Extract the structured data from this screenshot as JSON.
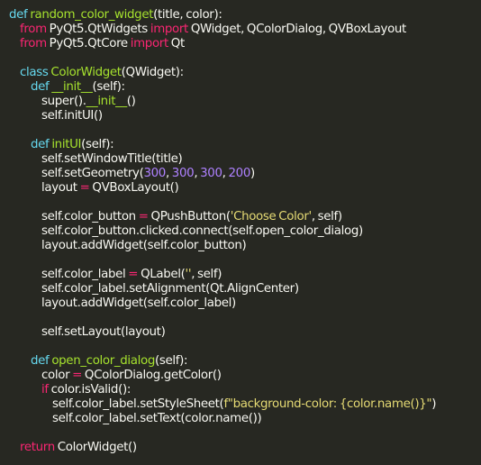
{
  "lines": [
    {
      "indent": 0,
      "tokens": [
        {
          "t": "kw",
          "v": "def "
        },
        {
          "t": "fn",
          "v": "random_color_widget"
        },
        {
          "t": "pl",
          "v": "(title, color):"
        }
      ]
    },
    {
      "indent": 1,
      "tokens": [
        {
          "t": "imp",
          "v": "from "
        },
        {
          "t": "pl",
          "v": "PyQt5.QtWidgets "
        },
        {
          "t": "imp",
          "v": "import "
        },
        {
          "t": "pl",
          "v": "QWidget, QColorDialog, QVBoxLayout"
        }
      ]
    },
    {
      "indent": 1,
      "tokens": [
        {
          "t": "imp",
          "v": "from "
        },
        {
          "t": "pl",
          "v": "PyQt5.QtCore "
        },
        {
          "t": "imp",
          "v": "import "
        },
        {
          "t": "pl",
          "v": "Qt"
        }
      ]
    },
    {
      "indent": 0,
      "tokens": []
    },
    {
      "indent": 1,
      "tokens": [
        {
          "t": "kw",
          "v": "class "
        },
        {
          "t": "fn",
          "v": "ColorWidget"
        },
        {
          "t": "pl",
          "v": "(QWidget):"
        }
      ]
    },
    {
      "indent": 2,
      "tokens": [
        {
          "t": "kw",
          "v": "def "
        },
        {
          "t": "fn",
          "v": "__init__"
        },
        {
          "t": "pl",
          "v": "(self):"
        }
      ]
    },
    {
      "indent": 3,
      "tokens": [
        {
          "t": "pl",
          "v": "super()."
        },
        {
          "t": "fn",
          "v": "__init__"
        },
        {
          "t": "pl",
          "v": "()"
        }
      ]
    },
    {
      "indent": 3,
      "tokens": [
        {
          "t": "pl",
          "v": "self.initUI()"
        }
      ]
    },
    {
      "indent": 0,
      "tokens": []
    },
    {
      "indent": 2,
      "tokens": [
        {
          "t": "kw",
          "v": "def "
        },
        {
          "t": "fn",
          "v": "initUI"
        },
        {
          "t": "pl",
          "v": "(self):"
        }
      ]
    },
    {
      "indent": 3,
      "tokens": [
        {
          "t": "pl",
          "v": "self.setWindowTitle(title)"
        }
      ]
    },
    {
      "indent": 3,
      "tokens": [
        {
          "t": "pl",
          "v": "self.setGeometry("
        },
        {
          "t": "num",
          "v": "300"
        },
        {
          "t": "pl",
          "v": ", "
        },
        {
          "t": "num",
          "v": "300"
        },
        {
          "t": "pl",
          "v": ", "
        },
        {
          "t": "num",
          "v": "300"
        },
        {
          "t": "pl",
          "v": ", "
        },
        {
          "t": "num",
          "v": "200"
        },
        {
          "t": "pl",
          "v": ")"
        }
      ]
    },
    {
      "indent": 3,
      "tokens": [
        {
          "t": "pl",
          "v": "layout "
        },
        {
          "t": "imp",
          "v": "= "
        },
        {
          "t": "pl",
          "v": "QVBoxLayout()"
        }
      ]
    },
    {
      "indent": 0,
      "tokens": []
    },
    {
      "indent": 3,
      "tokens": [
        {
          "t": "pl",
          "v": "self.color_button "
        },
        {
          "t": "imp",
          "v": "= "
        },
        {
          "t": "pl",
          "v": "QPushButton("
        },
        {
          "t": "str",
          "v": "'Choose Color'"
        },
        {
          "t": "pl",
          "v": ", self)"
        }
      ]
    },
    {
      "indent": 3,
      "tokens": [
        {
          "t": "pl",
          "v": "self.color_button.clicked.connect(self.open_color_dialog)"
        }
      ]
    },
    {
      "indent": 3,
      "tokens": [
        {
          "t": "pl",
          "v": "layout.addWidget(self.color_button)"
        }
      ]
    },
    {
      "indent": 0,
      "tokens": []
    },
    {
      "indent": 3,
      "tokens": [
        {
          "t": "pl",
          "v": "self.color_label "
        },
        {
          "t": "imp",
          "v": "= "
        },
        {
          "t": "pl",
          "v": "QLabel("
        },
        {
          "t": "str",
          "v": "''"
        },
        {
          "t": "pl",
          "v": ", self)"
        }
      ]
    },
    {
      "indent": 3,
      "tokens": [
        {
          "t": "pl",
          "v": "self.color_label.setAlignment(Qt.AlignCenter)"
        }
      ]
    },
    {
      "indent": 3,
      "tokens": [
        {
          "t": "pl",
          "v": "layout.addWidget(self.color_label)"
        }
      ]
    },
    {
      "indent": 0,
      "tokens": []
    },
    {
      "indent": 3,
      "tokens": [
        {
          "t": "pl",
          "v": "self.setLayout(layout)"
        }
      ]
    },
    {
      "indent": 0,
      "tokens": []
    },
    {
      "indent": 2,
      "tokens": [
        {
          "t": "kw",
          "v": "def "
        },
        {
          "t": "fn",
          "v": "open_color_dialog"
        },
        {
          "t": "pl",
          "v": "(self):"
        }
      ]
    },
    {
      "indent": 3,
      "tokens": [
        {
          "t": "pl",
          "v": "color "
        },
        {
          "t": "imp",
          "v": "= "
        },
        {
          "t": "pl",
          "v": "QColorDialog.getColor()"
        }
      ]
    },
    {
      "indent": 3,
      "tokens": [
        {
          "t": "imp",
          "v": "if "
        },
        {
          "t": "pl",
          "v": "color.isValid():"
        }
      ]
    },
    {
      "indent": 4,
      "tokens": [
        {
          "t": "pl",
          "v": "self.color_label.setStyleSheet("
        },
        {
          "t": "str",
          "v": "f\"background-color: {color.name()}\""
        },
        {
          "t": "pl",
          "v": ")"
        }
      ]
    },
    {
      "indent": 4,
      "tokens": [
        {
          "t": "pl",
          "v": "self.color_label.setText(color.name())"
        }
      ]
    },
    {
      "indent": 0,
      "tokens": []
    },
    {
      "indent": 1,
      "tokens": [
        {
          "t": "imp",
          "v": "return "
        },
        {
          "t": "pl",
          "v": "ColorWidget()"
        }
      ]
    }
  ]
}
